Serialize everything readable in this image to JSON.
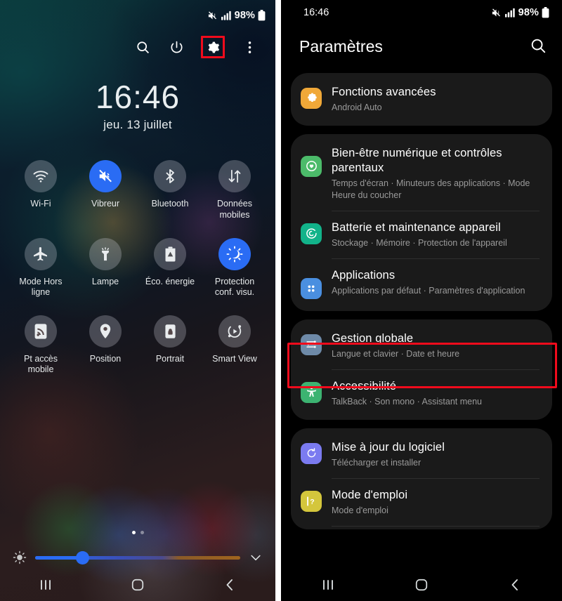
{
  "quick_settings": {
    "status_bar": {
      "battery_percent": "98%",
      "icons": [
        "mute-vibrate-icon",
        "signal-bars-icon",
        "battery-icon"
      ]
    },
    "toolbar": [
      {
        "name": "search-icon",
        "label": "Rechercher"
      },
      {
        "name": "power-icon",
        "label": "Marche/Arrêt"
      },
      {
        "name": "gear-icon",
        "label": "Paramètres",
        "highlighted": true
      },
      {
        "name": "more-vertical-icon",
        "label": "Plus d'options"
      }
    ],
    "clock": {
      "time": "16:46",
      "date": "jeu. 13 juillet"
    },
    "tiles": [
      {
        "label": "Wi-Fi",
        "icon": "wifi-icon",
        "active": false
      },
      {
        "label": "Vibreur",
        "icon": "vibrate-icon",
        "active": true
      },
      {
        "label": "Bluetooth",
        "icon": "bluetooth-icon",
        "active": false
      },
      {
        "label": "Données mobiles",
        "icon": "mobile-data-icon",
        "active": false
      },
      {
        "label": "Mode Hors ligne",
        "icon": "airplane-icon",
        "active": false
      },
      {
        "label": "Lampe",
        "icon": "flashlight-icon",
        "active": false
      },
      {
        "label": "Éco. énergie",
        "icon": "battery-saver-icon",
        "active": false
      },
      {
        "label": "Protection conf. visu.",
        "icon": "eye-comfort-icon",
        "active": true
      }
    ],
    "tiles_row3": [
      {
        "label": "Pt accès mobile",
        "icon": "hotspot-icon",
        "active": false
      },
      {
        "label": "Position",
        "icon": "location-pin-icon",
        "active": false
      },
      {
        "label": "Portrait",
        "icon": "rotation-lock-icon",
        "active": false
      },
      {
        "label": "Smart View",
        "icon": "smart-view-icon",
        "active": false
      }
    ],
    "pagination": {
      "current": 1,
      "total": 2
    },
    "brightness": {
      "value_percent": 23,
      "icon": "brightness-icon",
      "expand_icon": "chevron-down-icon"
    },
    "nav": [
      {
        "name": "recents-icon",
        "label": "Applications récentes"
      },
      {
        "name": "home-icon",
        "label": "Accueil"
      },
      {
        "name": "back-icon",
        "label": "Retour"
      }
    ],
    "accent_color": "#2a6cf4",
    "highlight_color": "#f00b1c"
  },
  "settings": {
    "status_bar": {
      "time": "16:46",
      "battery_percent": "98%"
    },
    "header": {
      "title": "Paramètres",
      "search_icon": "search-icon"
    },
    "groups": [
      {
        "rows": [
          {
            "title": "Fonctions avancées",
            "subtitle": "Android Auto",
            "icon": "advanced-features-icon",
            "icon_color": "#f0a838",
            "highlighted": false
          }
        ]
      },
      {
        "rows": [
          {
            "title": "Bien-être numérique et contrôles parentaux",
            "subtitle": "Temps d'écran · Minuteurs des applications · Mode Heure du coucher",
            "icon": "digital-wellbeing-icon",
            "icon_color": "#4cbb6a",
            "highlighted": false
          },
          {
            "title": "Batterie et maintenance appareil",
            "subtitle": "Stockage · Mémoire · Protection de l'appareil",
            "icon": "device-care-icon",
            "icon_color": "#12b38a",
            "highlighted": false
          },
          {
            "title": "Applications",
            "subtitle": "Applications par défaut · Paramètres d'application",
            "icon": "apps-icon",
            "icon_color": "#4a8fe0",
            "highlighted": false
          }
        ]
      },
      {
        "rows": [
          {
            "title": "Gestion globale",
            "subtitle": "Langue et clavier · Date et heure",
            "icon": "general-management-icon",
            "icon_color": "#6e8aa8",
            "highlighted": true
          },
          {
            "title": "Accessibilité",
            "subtitle": "TalkBack · Son mono · Assistant menu",
            "icon": "accessibility-icon",
            "icon_color": "#3cb371",
            "highlighted": false
          }
        ]
      },
      {
        "rows": [
          {
            "title": "Mise à jour du logiciel",
            "subtitle": "Télécharger et installer",
            "icon": "software-update-icon",
            "icon_color": "#7b7bf0",
            "highlighted": false
          },
          {
            "title": "Mode d'emploi",
            "subtitle": "Mode d'emploi",
            "icon": "user-manual-icon",
            "icon_color": "#d4c63c",
            "highlighted": false
          }
        ]
      }
    ],
    "nav": [
      {
        "name": "recents-icon",
        "label": "Applications récentes"
      },
      {
        "name": "home-icon",
        "label": "Accueil"
      },
      {
        "name": "back-icon",
        "label": "Retour"
      }
    ]
  }
}
